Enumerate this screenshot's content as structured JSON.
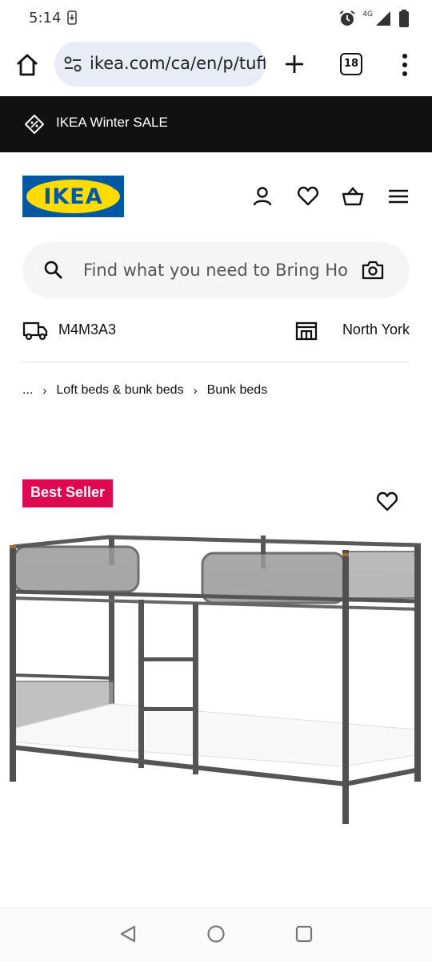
{
  "status_bar": {
    "time": "5:14",
    "network": "4G"
  },
  "browser": {
    "url": "ikea.com/ca/en/p/tuffing-bunk-bed-frame-dark-grey",
    "tab_count": "18"
  },
  "promo": {
    "text": "IKEA Winter SALE"
  },
  "header": {
    "logo_text": "IKEA",
    "logo_colors": {
      "blue": "#0058a3",
      "yellow": "#ffdb00"
    }
  },
  "search": {
    "placeholder": "Find what you need to Bring Home"
  },
  "location": {
    "postal_code": "M4M3A3",
    "store": "North York"
  },
  "breadcrumb": {
    "items": [
      "...",
      "Loft beds & bunk beds",
      "Bunk beds"
    ]
  },
  "product": {
    "badge": "Best Seller",
    "badge_color": "#e00751",
    "image_alt": "bunk-bed-frame"
  }
}
